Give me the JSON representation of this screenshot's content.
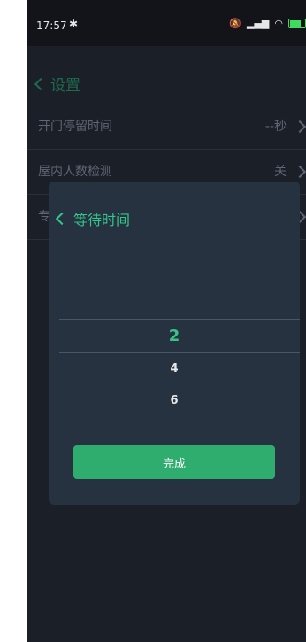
{
  "status_bar": {
    "time": "17:57",
    "bluetooth_glyph": "✱",
    "icons": [
      "bell-off-icon",
      "signal-icon",
      "wifi-icon",
      "battery-icon"
    ]
  },
  "page": {
    "title": "设置"
  },
  "settings": [
    {
      "label": "开门停留时间",
      "value": "--秒"
    },
    {
      "label": "屋内人数检测",
      "value": "关"
    },
    {
      "label": "专",
      "value": ""
    }
  ],
  "dialog": {
    "title": "等待时间",
    "options": [
      "2",
      "4",
      "6"
    ],
    "selected": "2",
    "done_label": "完成"
  },
  "colors": {
    "accent": "#35c58a",
    "button": "#2ead6f",
    "dialog_bg": "#263240",
    "screen_bg": "#1b1f28"
  }
}
